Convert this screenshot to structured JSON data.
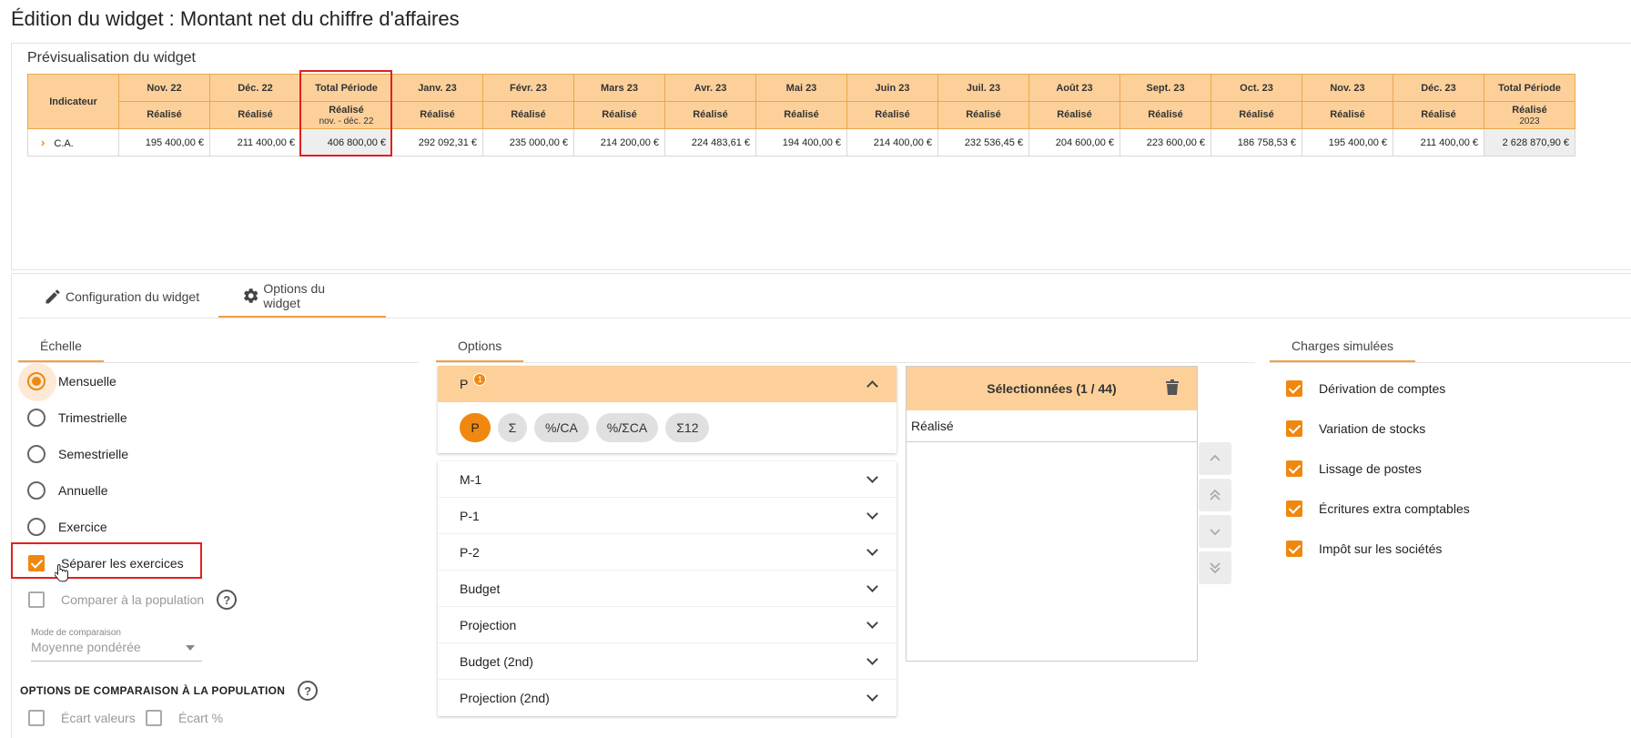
{
  "page": {
    "title": "Édition du widget : Montant net du chiffre d'affaires"
  },
  "preview": {
    "title": "Prévisualisation du widget",
    "indicator_header": "Indicateur",
    "columns": [
      {
        "label": "Nov. 22",
        "sub": "Réalisé",
        "note": ""
      },
      {
        "label": "Déc. 22",
        "sub": "Réalisé",
        "note": ""
      },
      {
        "label": "Total Période",
        "sub": "Réalisé",
        "note": "nov. - déc. 22"
      },
      {
        "label": "Janv. 23",
        "sub": "Réalisé",
        "note": ""
      },
      {
        "label": "Févr. 23",
        "sub": "Réalisé",
        "note": ""
      },
      {
        "label": "Mars 23",
        "sub": "Réalisé",
        "note": ""
      },
      {
        "label": "Avr. 23",
        "sub": "Réalisé",
        "note": ""
      },
      {
        "label": "Mai 23",
        "sub": "Réalisé",
        "note": ""
      },
      {
        "label": "Juin 23",
        "sub": "Réalisé",
        "note": ""
      },
      {
        "label": "Juil. 23",
        "sub": "Réalisé",
        "note": ""
      },
      {
        "label": "Août 23",
        "sub": "Réalisé",
        "note": ""
      },
      {
        "label": "Sept. 23",
        "sub": "Réalisé",
        "note": ""
      },
      {
        "label": "Oct. 23",
        "sub": "Réalisé",
        "note": ""
      },
      {
        "label": "Nov. 23",
        "sub": "Réalisé",
        "note": ""
      },
      {
        "label": "Déc. 23",
        "sub": "Réalisé",
        "note": ""
      },
      {
        "label": "Total Période",
        "sub": "Réalisé",
        "note": "2023"
      }
    ],
    "row": {
      "label": "C.A.",
      "values": [
        "195 400,00 €",
        "211 400,00 €",
        "406 800,00 €",
        "292 092,31 €",
        "235 000,00 €",
        "214 200,00 €",
        "224 483,61 €",
        "194 400,00 €",
        "214 400,00 €",
        "232 536,45 €",
        "204 600,00 €",
        "223 600,00 €",
        "186 758,53 €",
        "195 400,00 €",
        "211 400,00 €",
        "2 628 870,90 €"
      ]
    }
  },
  "tabs": {
    "config": "Configuration du widget",
    "options": "Options du widget"
  },
  "echelle": {
    "title": "Échelle",
    "options": [
      "Mensuelle",
      "Trimestrielle",
      "Semestrielle",
      "Annuelle",
      "Exercice"
    ],
    "selected": "Mensuelle",
    "separate_label": "Séparer les exercices",
    "compare_label": "Comparer à la population",
    "mode_label": "Mode de comparaison",
    "mode_value": "Moyenne pondérée",
    "pop_options_title": "Options de comparaison à la population",
    "ecart_valeurs": "Écart valeurs",
    "ecart_pct": "Écart %"
  },
  "options": {
    "title": "Options",
    "open_item": {
      "label": "P",
      "badge": "1"
    },
    "chips": [
      "P",
      "Σ",
      "%/CA",
      "%/ΣCA",
      "Σ12"
    ],
    "items": [
      "M-1",
      "P-1",
      "P-2",
      "Budget",
      "Projection",
      "Budget (2nd)",
      "Projection (2nd)"
    ]
  },
  "selected_panel": {
    "title": "Sélectionnées (1 / 44)",
    "items": [
      "Réalisé"
    ]
  },
  "charges": {
    "title": "Charges simulées",
    "items": [
      "Dérivation de comptes",
      "Variation de stocks",
      "Lissage de postes",
      "Écritures extra comptables",
      "Impôt sur les sociétés"
    ]
  },
  "colors": {
    "accent": "#f0880f",
    "header_bg": "#fdd09a",
    "highlight": "#e02020"
  }
}
